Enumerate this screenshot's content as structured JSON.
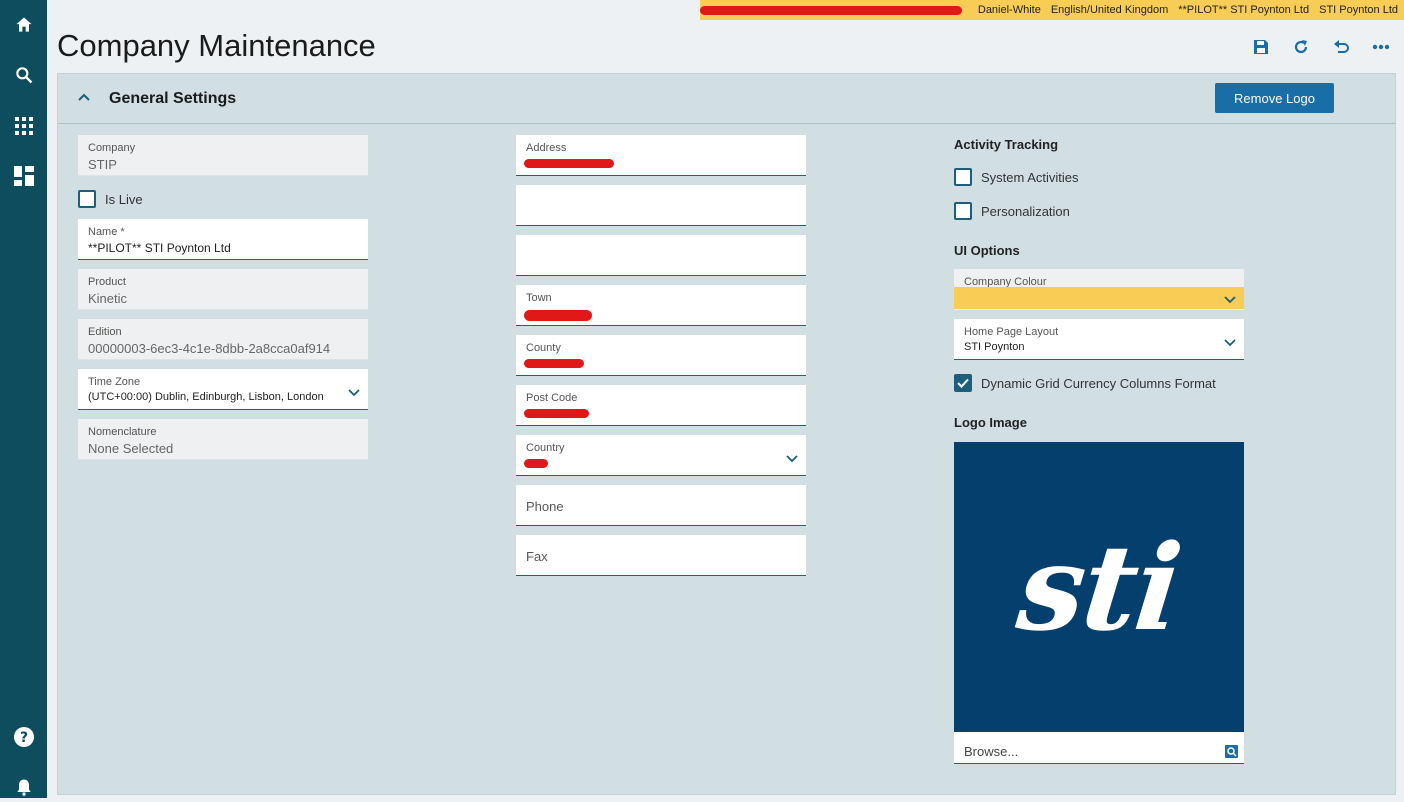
{
  "context_bar": {
    "user": "Daniel-White",
    "language": "English/United Kingdom",
    "company": "**PILOT** STI Poynton Ltd",
    "site": "STI Poynton Ltd"
  },
  "page": {
    "title": "Company Maintenance"
  },
  "section": {
    "title": "General Settings",
    "remove_logo_label": "Remove Logo"
  },
  "left_column": {
    "company": {
      "label": "Company",
      "value": "STIP"
    },
    "is_live": {
      "label": "Is Live",
      "checked": false
    },
    "name": {
      "label": "Name *",
      "value": "**PILOT** STI Poynton Ltd"
    },
    "product": {
      "label": "Product",
      "value": "Kinetic"
    },
    "edition": {
      "label": "Edition",
      "value": "00000003-6ec3-4c1e-8dbb-2a8cca0af914"
    },
    "time_zone": {
      "label": "Time Zone",
      "value": "(UTC+00:00) Dublin, Edinburgh, Lisbon, London"
    },
    "nomenclature": {
      "label": "Nomenclature",
      "value": "None Selected"
    }
  },
  "middle_column": {
    "address_label": "Address",
    "town_label": "Town",
    "county_label": "County",
    "post_code_label": "Post Code",
    "country_label": "Country",
    "phone_placeholder": "Phone",
    "fax_placeholder": "Fax"
  },
  "right_column": {
    "activity_tracking_title": "Activity Tracking",
    "system_activities": {
      "label": "System Activities",
      "checked": false
    },
    "personalization": {
      "label": "Personalization",
      "checked": false
    },
    "ui_options_title": "UI Options",
    "company_colour": {
      "label": "Company Colour",
      "color": "#f7cd55"
    },
    "home_page_layout": {
      "label": "Home Page Layout",
      "value": "STI Poynton"
    },
    "dynamic_grid": {
      "label": "Dynamic Grid Currency Columns Format",
      "checked": true
    },
    "logo_image_title": "Logo Image",
    "logo_text": "sti",
    "browse_placeholder": "Browse..."
  },
  "icons": {
    "sidebar": [
      "home-icon",
      "search-icon",
      "apps-grid-icon",
      "dashboard-icon",
      "help-icon",
      "notification-bell-icon"
    ],
    "toolbar": [
      "save-icon",
      "refresh-icon",
      "undo-icon",
      "more-icon"
    ]
  },
  "colors": {
    "sidebar": "#0e4d5e",
    "accent": "#1a6ea8",
    "context_bar": "#f7cd55",
    "panel": "#d1dfe3",
    "logo_background": "#043f6e"
  }
}
